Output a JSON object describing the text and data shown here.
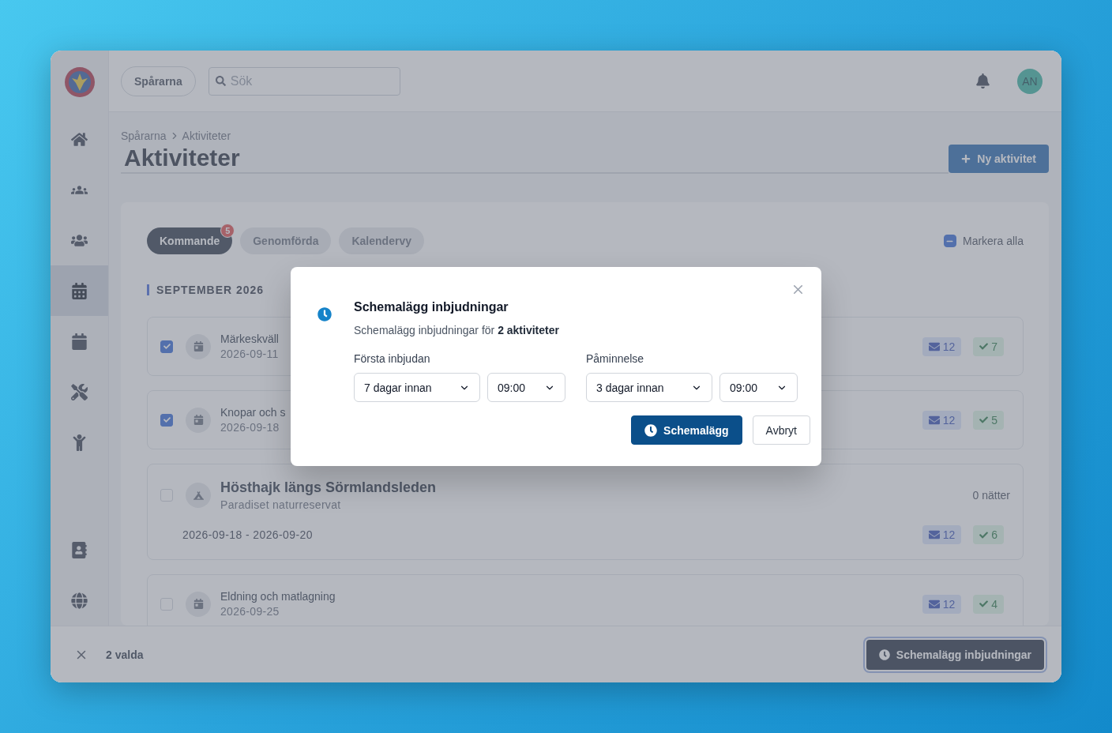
{
  "topbar": {
    "org_button": "Spårarna",
    "search": {
      "placeholder": "Sök"
    },
    "avatar": "AN"
  },
  "sidebar": {
    "items": [
      {
        "selected": false
      },
      {
        "selected": false
      },
      {
        "selected": false
      },
      {
        "selected": true
      },
      {
        "selected": false
      },
      {
        "selected": false
      },
      {
        "selected": false
      },
      {
        "selected": false
      },
      {
        "selected": false
      }
    ]
  },
  "breadcrumb": [
    "Spårarna",
    "Aktiviteter"
  ],
  "title": "Aktiviteter",
  "new_button": "Ny aktivitet",
  "tabs": [
    {
      "label": "Kommande",
      "selected": true,
      "badge": "5"
    },
    {
      "label": "Genomförda",
      "selected": false
    },
    {
      "label": "Kalendervy",
      "selected": false
    }
  ],
  "select_all": {
    "label": "Markera alla",
    "indeterminate": true
  },
  "month": "SEPTEMBER 2026",
  "activities": [
    {
      "kind": "event",
      "checked": true,
      "title": "Märkeskväll",
      "date": "2026-09-11",
      "invited": "12",
      "accepted": "7"
    },
    {
      "kind": "event",
      "checked": true,
      "title": "Knopar och s",
      "date": "2026-09-18",
      "invited": "12",
      "accepted": "5"
    },
    {
      "kind": "trip",
      "checked": false,
      "title": "Hösthajk längs Sörmlandsleden",
      "place": "Paradiset naturreservat",
      "nights": "0 nätter",
      "dates": "2026-09-18 - 2026-09-20",
      "invited": "12",
      "accepted": "6"
    },
    {
      "kind": "event",
      "checked": false,
      "title": "Eldning och matlagning",
      "date": "2026-09-25",
      "invited": "12",
      "accepted": "4"
    }
  ],
  "selection_bar": {
    "count": "2 valda",
    "action": "Schemalägg inbjudningar"
  },
  "dialog": {
    "title": "Schemalägg inbjudningar",
    "text": "Schemalägg inbjudningar för **2 aktiviteter**",
    "groups": [
      {
        "label": "Första inbjudan",
        "days": "7 dagar innan",
        "time": "09:00"
      },
      {
        "label": "Påminnelse",
        "days": "3 dagar innan",
        "time": "09:00"
      }
    ],
    "buttons": [
      {
        "kind": "primary",
        "label": "Schemalägg"
      },
      {
        "kind": "secondary",
        "label": "Avbryt"
      }
    ]
  }
}
